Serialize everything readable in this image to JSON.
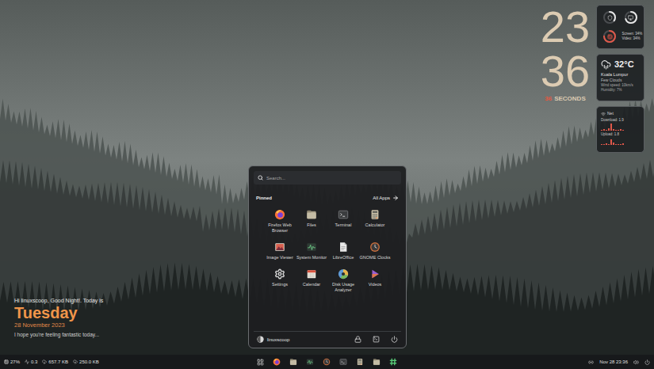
{
  "clock": {
    "hours": "23",
    "minutes": "36",
    "seconds": "36",
    "seconds_label": "SECONDS"
  },
  "system_widget": {
    "gauges": [
      {
        "level": 0.35,
        "color": "#e6e6e6"
      },
      {
        "level": 0.7,
        "color": "#e6e6e6"
      },
      {
        "level": 0.75,
        "color": "#e0584a"
      }
    ],
    "readings": [
      "Screen: 34%",
      "Video: 34%"
    ]
  },
  "weather": {
    "temperature": "32°C",
    "city": "Kuala Lumpur",
    "condition": "Few Clouds",
    "details": [
      "Wind speed: 10km/s",
      "Humidity: 7%"
    ]
  },
  "network": {
    "title": "Net",
    "rows": [
      {
        "label": "Download: 1.9",
        "values": [
          1,
          2,
          1,
          3,
          8,
          2,
          1,
          1,
          2,
          1
        ]
      },
      {
        "label": "Upload: 1.8",
        "values": [
          1,
          1,
          2,
          1,
          6,
          3,
          1,
          1,
          1,
          2
        ]
      }
    ]
  },
  "greeting": {
    "line": "Hi linuxscoop, Good Night!. Today is",
    "day": "Tuesday",
    "date": "28 November 2023",
    "message": "I hope you're feeling fantastic today..."
  },
  "start_menu": {
    "search": {
      "placeholder": "Search..."
    },
    "section": "Pinned",
    "all_apps": "All Apps",
    "apps": [
      "Firefox Web Browser",
      "Files",
      "Terminal",
      "Calculator",
      "Image Viewer",
      "System Monitor",
      "LibreOffice",
      "GNOME Clocks",
      "Settings",
      "Calendar",
      "Disk Usage Analyzer",
      "Videos"
    ],
    "user": "linuxscoop"
  },
  "taskbar": {
    "stats": [
      "27%",
      "0.3",
      "657.7 KB",
      "250.0 KB"
    ],
    "datetime": "Nov 28 23:36"
  }
}
